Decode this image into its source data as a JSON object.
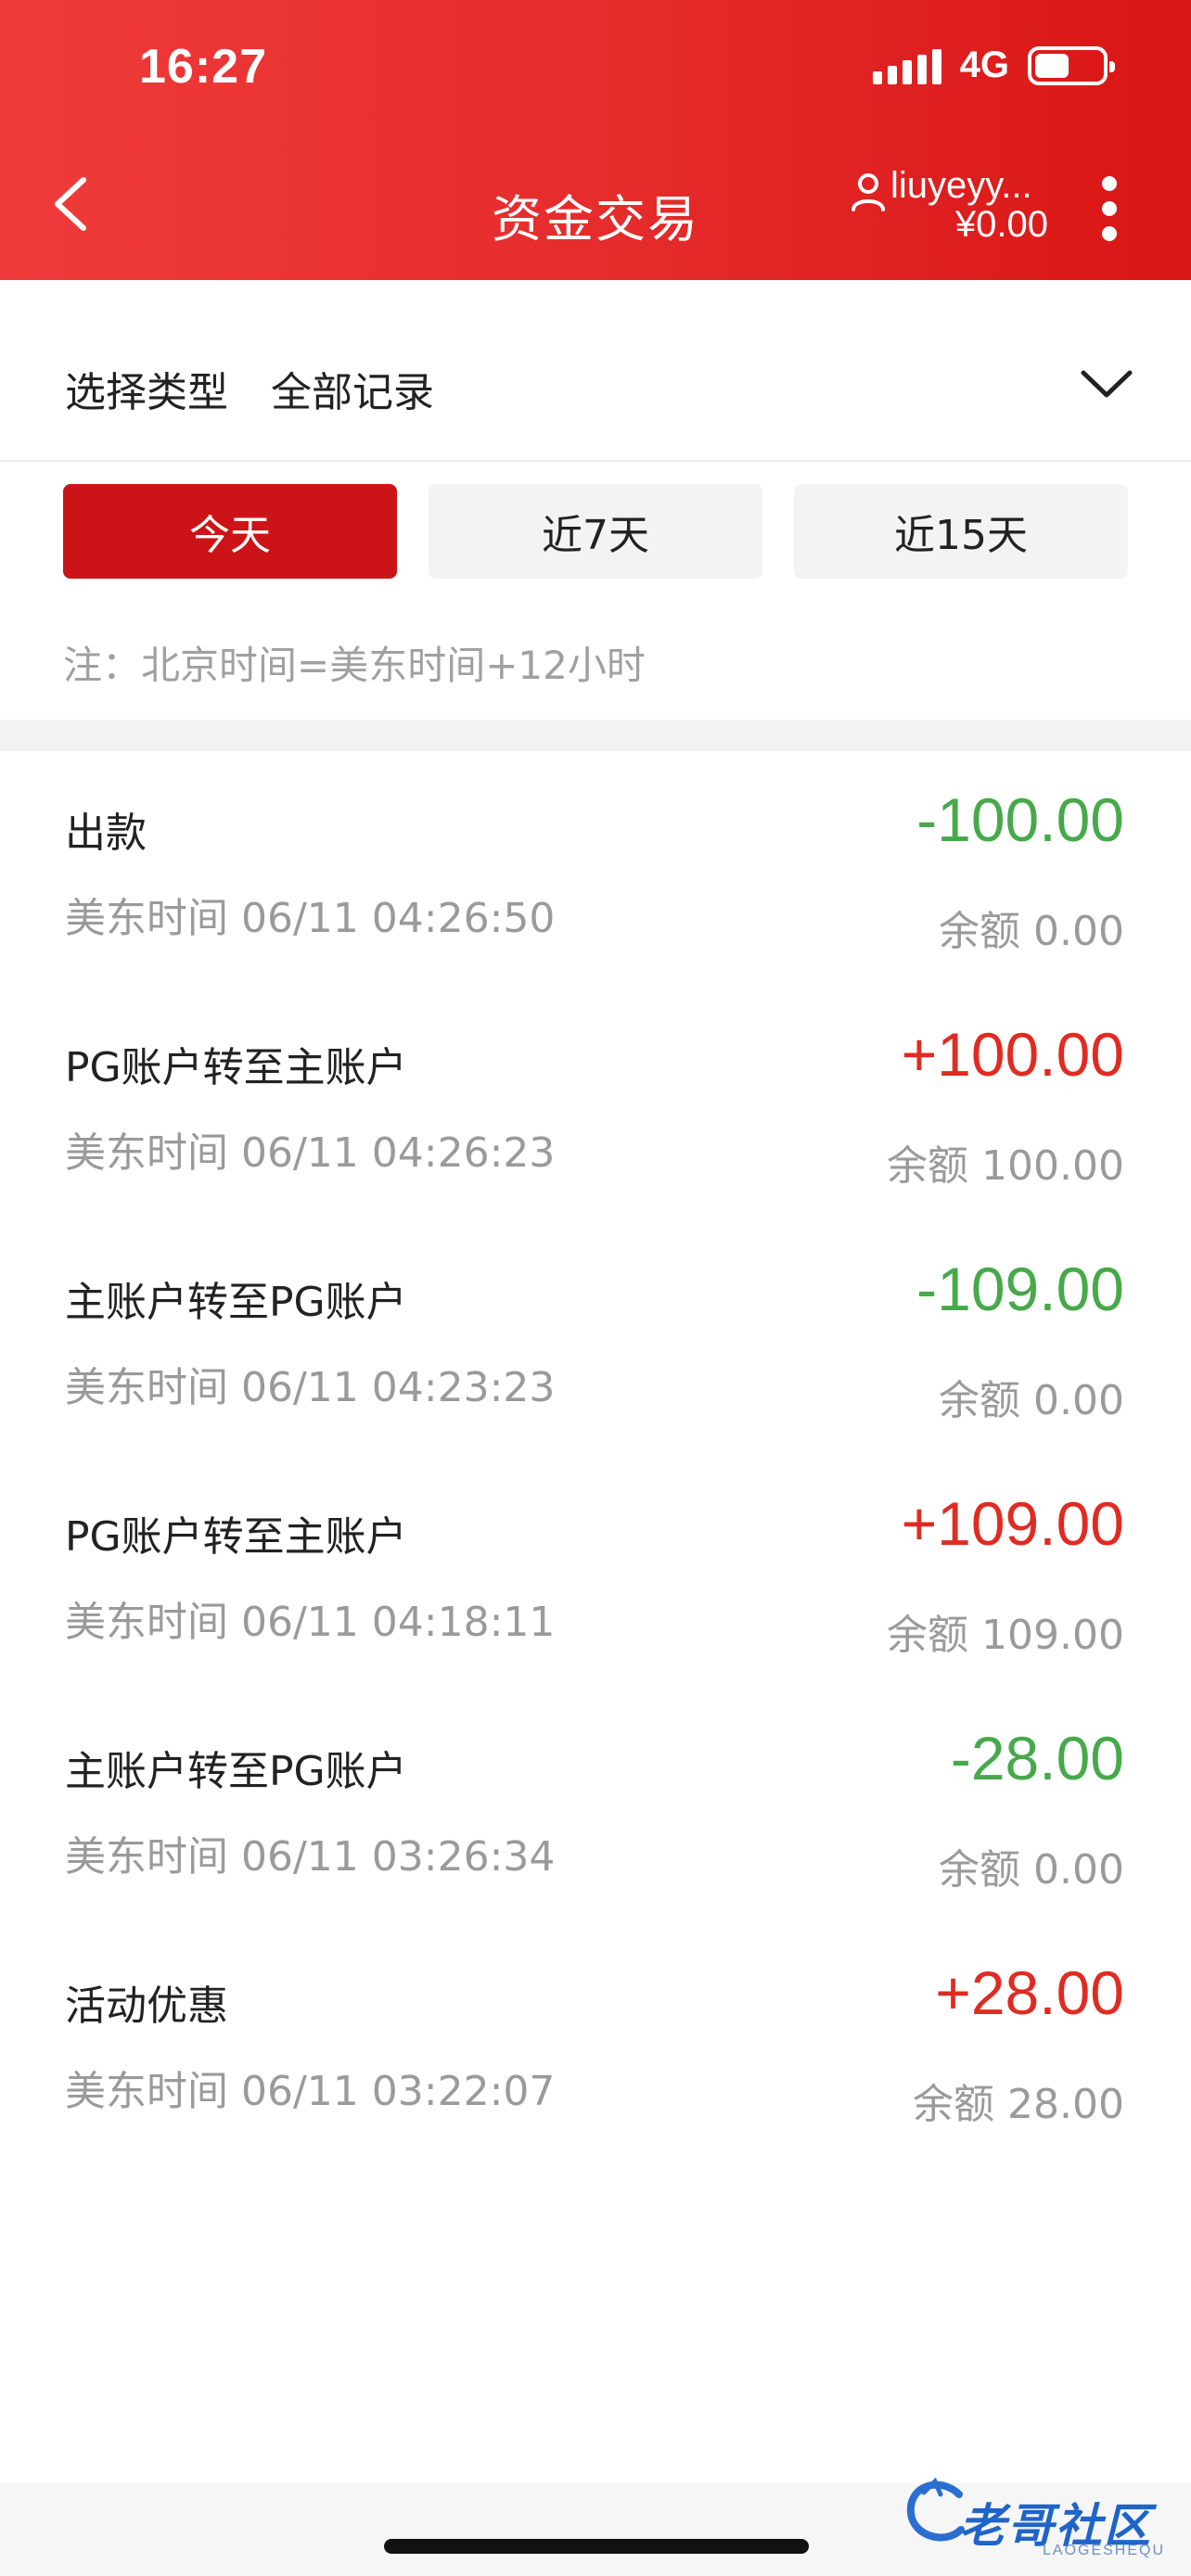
{
  "status_bar": {
    "time": "16:27",
    "network": "4G"
  },
  "header": {
    "title": "资金交易",
    "account_name": "liuyeyy...",
    "account_balance": "¥0.00",
    "background_color": "#e52a2a"
  },
  "filter": {
    "type_label": "选择类型",
    "type_value": "全部记录",
    "ranges": [
      {
        "label": "今天",
        "active": true
      },
      {
        "label": "近7天",
        "active": false
      },
      {
        "label": "近15天",
        "active": false
      }
    ],
    "note": "注：北京时间=美东时间+12小时"
  },
  "transactions": [
    {
      "type": "出款",
      "time": "美东时间 06/11 04:26:50",
      "amount": "-100.00",
      "balance": "余额 0.00",
      "direction": "neg"
    },
    {
      "type": "PG账户转至主账户",
      "time": "美东时间 06/11 04:26:23",
      "amount": "+100.00",
      "balance": "余额 100.00",
      "direction": "pos"
    },
    {
      "type": "主账户转至PG账户",
      "time": "美东时间 06/11 04:23:23",
      "amount": "-109.00",
      "balance": "余额 0.00",
      "direction": "neg"
    },
    {
      "type": "PG账户转至主账户",
      "time": "美东时间 06/11 04:18:11",
      "amount": "+109.00",
      "balance": "余额 109.00",
      "direction": "pos"
    },
    {
      "type": "主账户转至PG账户",
      "time": "美东时间 06/11 03:26:34",
      "amount": "-28.00",
      "balance": "余额 0.00",
      "direction": "neg"
    },
    {
      "type": "活动优惠",
      "time": "美东时间 06/11 03:22:07",
      "amount": "+28.00",
      "balance": "余额 28.00",
      "direction": "pos"
    }
  ],
  "colors": {
    "negative": "#46a94a",
    "positive": "#e02b22",
    "active_tab": "#cc1418"
  },
  "watermark": {
    "text": "老哥社区",
    "sub": "LAOGESHEQU"
  }
}
